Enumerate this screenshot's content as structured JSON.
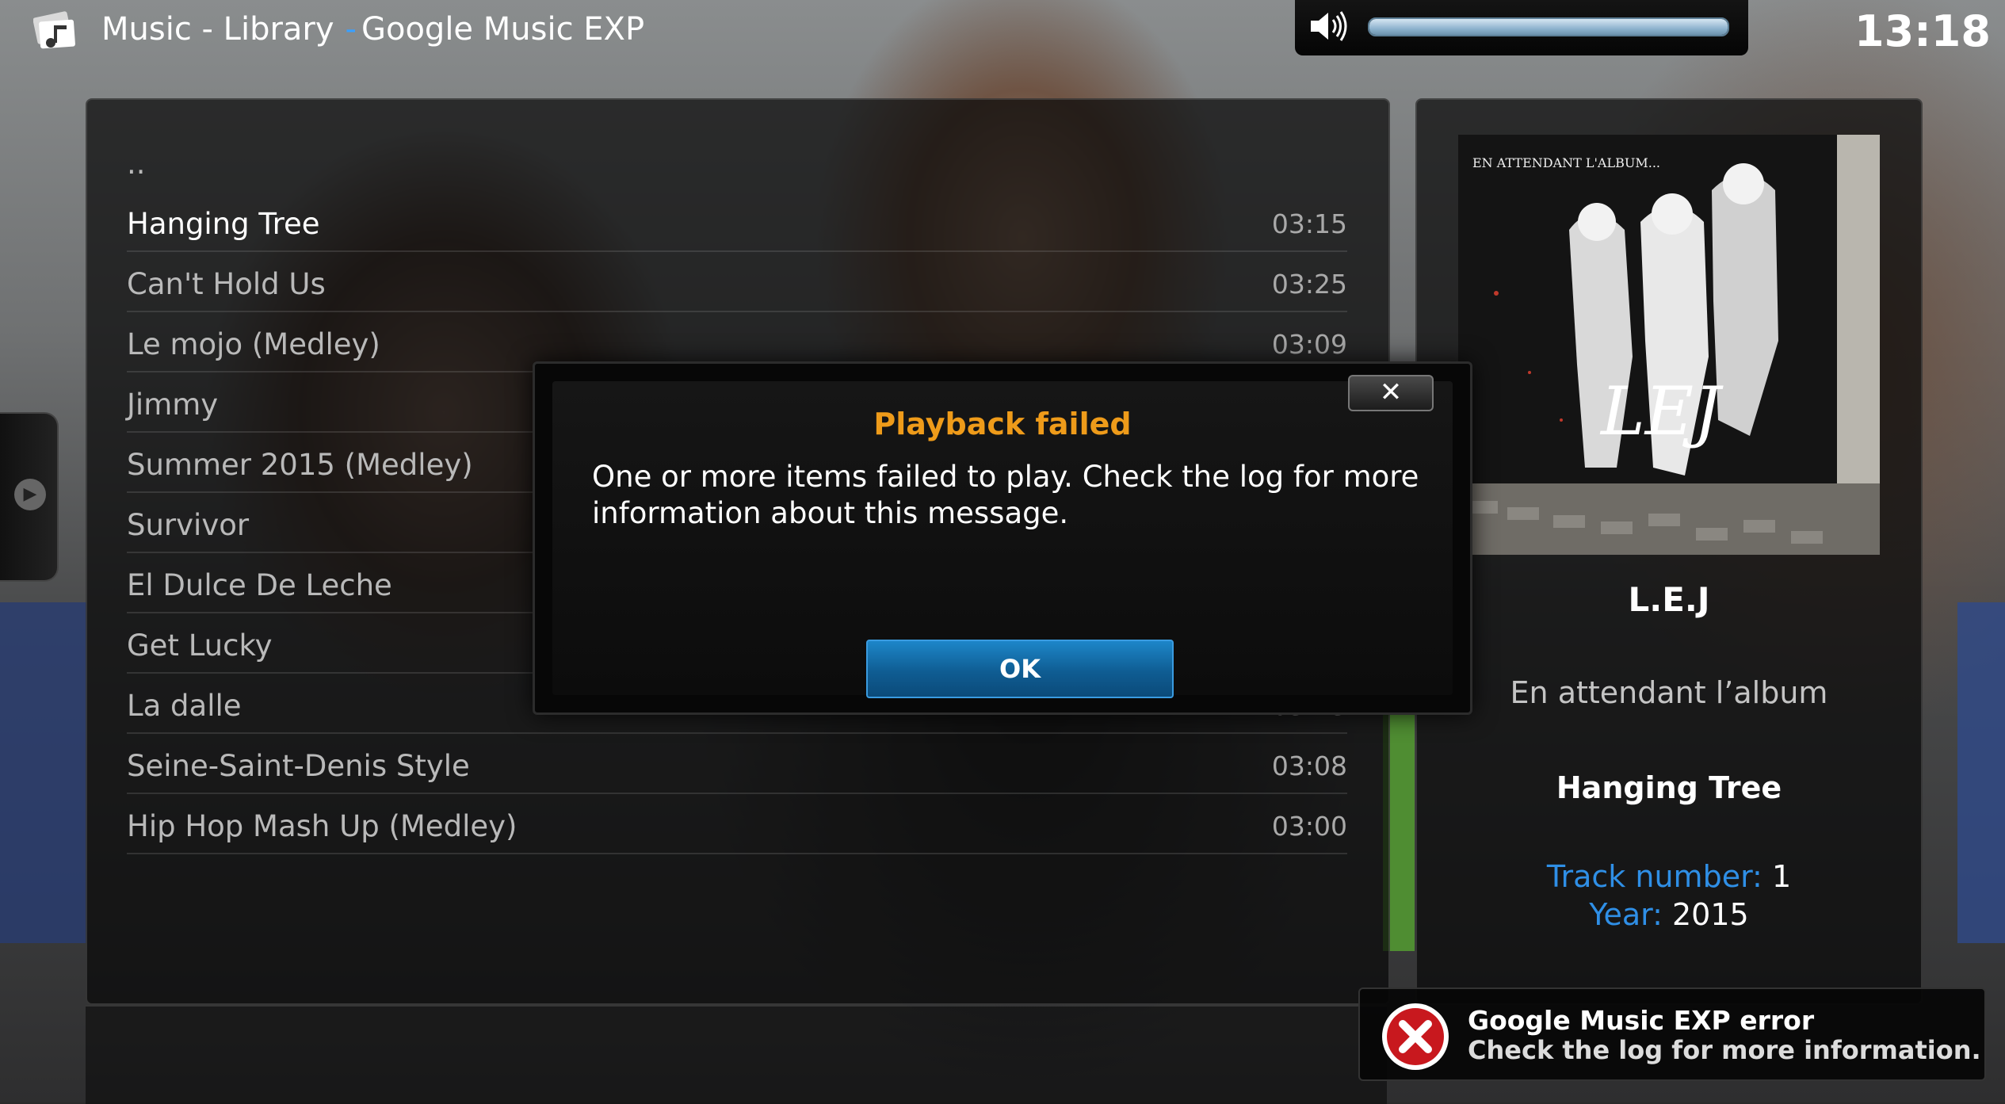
{
  "header": {
    "section": "Music - Library",
    "separator": "-",
    "addon": "Google Music EXP",
    "clock": "13:18"
  },
  "volume": {
    "level": 1.0,
    "icon": "speaker-icon"
  },
  "list": {
    "parent_label": "..",
    "items": [
      {
        "title": "Hanging Tree",
        "duration": "03:15"
      },
      {
        "title": "Can't Hold Us",
        "duration": "03:25"
      },
      {
        "title": "Le mojo (Medley)",
        "duration": "03:09"
      },
      {
        "title": "Jimmy",
        "duration": ""
      },
      {
        "title": "Summer 2015 (Medley)",
        "duration": ""
      },
      {
        "title": "Survivor",
        "duration": ""
      },
      {
        "title": "El Dulce De Leche",
        "duration": ""
      },
      {
        "title": "Get Lucky",
        "duration": ""
      },
      {
        "title": "La dalle",
        "duration": "03:23"
      },
      {
        "title": "Seine-Saint-Denis Style",
        "duration": "03:08"
      },
      {
        "title": "Hip Hop Mash Up (Medley)",
        "duration": "03:00"
      }
    ]
  },
  "info": {
    "cover_text_top": "EN ATTENDANT L'ALBUM...",
    "cover_logo": "LEJ",
    "artist": "L.E.J",
    "album": "En attendant l’album",
    "song": "Hanging Tree",
    "track_label": "Track number:",
    "track_value": "1",
    "year_label": "Year:",
    "year_value": "2015"
  },
  "dialog": {
    "title": "Playback failed",
    "message": "One or more items failed to play. Check the log for more information about this message.",
    "ok_label": "OK",
    "close_glyph": "✕"
  },
  "toast": {
    "title": "Google Music EXP error",
    "message": "Check the log for more information."
  },
  "colors": {
    "accent_blue": "#2f8fe6",
    "dialog_title": "#ee9b1a",
    "error_red": "#c8181e"
  }
}
